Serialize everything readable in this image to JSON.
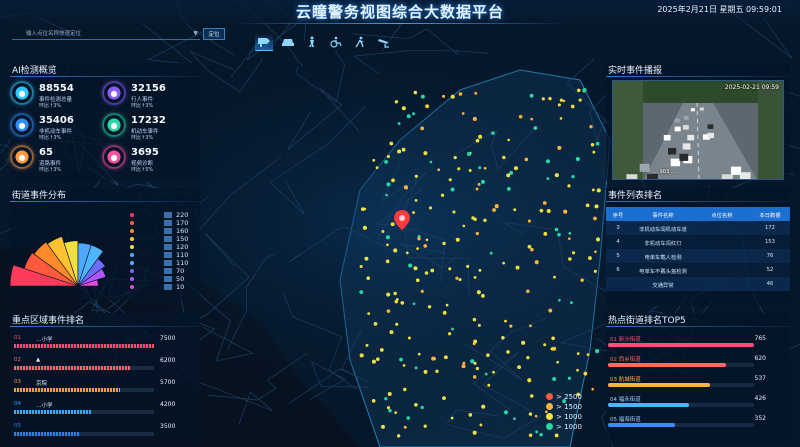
{
  "header": {
    "title": "云瞳警务视图综合大数据平台",
    "datetime": "2025年2月21日 星期五 09:59:01"
  },
  "search": {
    "placeholder": "输入点位名称快速定位",
    "button": "定位"
  },
  "category_icons": [
    {
      "icon": "camera-icon",
      "active": true
    },
    {
      "icon": "car-icon",
      "active": false
    },
    {
      "icon": "pedestrian-icon",
      "active": false
    },
    {
      "icon": "wheelchair-icon",
      "active": false
    },
    {
      "icon": "walking-icon",
      "active": false
    },
    {
      "icon": "cctv-icon",
      "active": false
    }
  ],
  "ai_overview": {
    "title": "AI检测概览",
    "items": [
      {
        "value": "88554",
        "label": "事件检测总量",
        "ratio": "环比↑3%",
        "color": "#2ec6ff",
        "icon": "pie-icon"
      },
      {
        "value": "32156",
        "label": "行人事件",
        "ratio": "环比↑3%",
        "color": "#8a5bff",
        "icon": "person-icon"
      },
      {
        "value": "35406",
        "label": "非机动车事件",
        "ratio": "环比↑3%",
        "color": "#2f8cff",
        "icon": "bike-icon"
      },
      {
        "value": "17232",
        "label": "机动车事件",
        "ratio": "环比↑3%",
        "color": "#27d9a6",
        "icon": "car-icon"
      },
      {
        "value": "65",
        "label": "道路事件",
        "ratio": "环比↑3%",
        "color": "#ff9a3c",
        "icon": "road-icon"
      },
      {
        "value": "3695",
        "label": "视频诊断",
        "ratio": "环比↑5%",
        "color": "#ff4fa0",
        "icon": "video-icon"
      }
    ]
  },
  "street_distribution": {
    "title": "街道事件分布",
    "chart_data": {
      "type": "pie",
      "values": [
        220,
        170,
        160,
        150,
        120,
        110,
        110,
        70,
        50,
        10
      ],
      "colors": [
        "#ff3b5c",
        "#ff5a3c",
        "#ff8a2a",
        "#ffc233",
        "#f0e040",
        "#4fa8ff",
        "#4db6ff",
        "#6f6bff",
        "#b055ff",
        "#e24bd8"
      ]
    }
  },
  "key_areas": {
    "title": "重点区域事件排名",
    "items": [
      {
        "rank": "01",
        "name": "…小学",
        "value": 7500,
        "color": "#ff4f6d"
      },
      {
        "rank": "02",
        "name": "▲",
        "value": 6200,
        "color": "#ff6b6b"
      },
      {
        "rank": "03",
        "name": "京院",
        "value": 5700,
        "color": "#ff9a3c"
      },
      {
        "rank": "04",
        "name": "…小学",
        "value": 4200,
        "color": "#3aa9ff"
      },
      {
        "rank": "05",
        "name": "",
        "value": 3500,
        "color": "#2f7fe6"
      }
    ],
    "max": 7500
  },
  "live_video": {
    "title": "实时事件播报",
    "stamp": "2025-02-21 09:59",
    "caption": "… 903 …"
  },
  "event_list": {
    "title": "事件列表排名",
    "columns": [
      "序号",
      "事件名称",
      "点位名称",
      "本日数据"
    ],
    "rows": [
      [
        "3",
        "非机动车闯机动车道",
        "",
        "172"
      ],
      [
        "4",
        "非机动车闯红灯",
        "",
        "153"
      ],
      [
        "5",
        "电单车载人检测",
        "",
        "76"
      ],
      [
        "6",
        "电单车不戴头盔检测",
        "",
        "52"
      ],
      [
        "",
        "交通异常",
        "",
        "46"
      ]
    ]
  },
  "top5": {
    "title": "热点街道排名TOP5",
    "items": [
      {
        "label": "01 新沙街道",
        "value": 765,
        "color": "#ff4f7a"
      },
      {
        "label": "02 西乡街道",
        "value": 620,
        "color": "#ff6a5c"
      },
      {
        "label": "03 航城街道",
        "value": 537,
        "color": "#ffb23c"
      },
      {
        "label": "04 福永街道",
        "value": 426,
        "color": "#4fb3ff"
      },
      {
        "label": "05 福海街道",
        "value": 352,
        "color": "#3a8cff"
      }
    ],
    "max": 765
  },
  "map_legend": [
    {
      "label": "> 2500",
      "color": "#ff5a3c"
    },
    {
      "label": "> 1500",
      "color": "#ffb23c"
    },
    {
      "label": "> 1000",
      "color": "#f0e040"
    },
    {
      "label": "> 1000",
      "color": "#27d9a6"
    }
  ]
}
